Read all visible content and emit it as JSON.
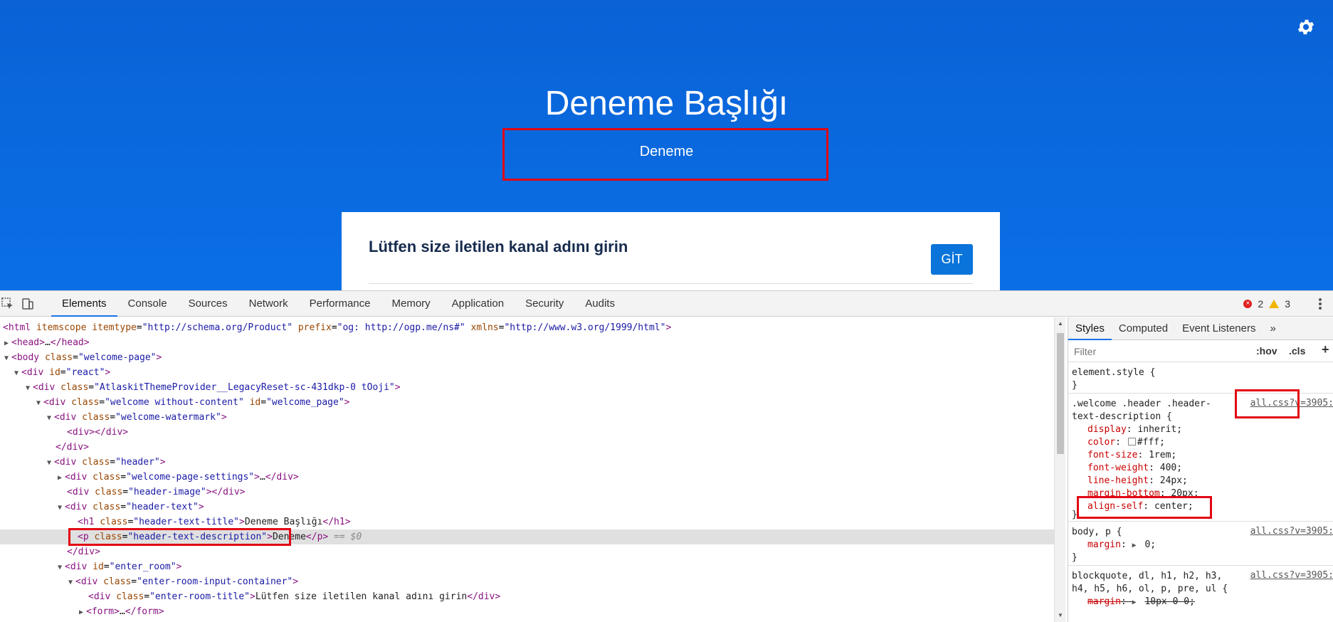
{
  "page": {
    "title": "Deneme Başlığı",
    "description": "Deneme",
    "card_title": "Lütfen size iletilen kanal adını girin",
    "go_button": "GİT",
    "settings_icon": "gear-icon",
    "background": "#0a6fe6"
  },
  "devtools": {
    "tabs": [
      "Elements",
      "Console",
      "Sources",
      "Network",
      "Performance",
      "Memory",
      "Application",
      "Security",
      "Audits"
    ],
    "error_count": "2",
    "warning_count": "3",
    "elements": {
      "l0": {
        "o": "<html ",
        "a1": "itemscope",
        "a2": " itemtype",
        "v2": "\"http://schema.org/Product\"",
        "a3": " prefix",
        "v3": "\"og: http://ogp.me/ns#\"",
        "a4": " xmlns",
        "v4": "\"http://www.w3.org/1999/html\"",
        "c": ">"
      },
      "l1": {
        "o": "<head>",
        "t": "…",
        "c": "</head>"
      },
      "l2": {
        "o": "<body ",
        "a": "class",
        "v": "\"welcome-page\"",
        "c": ">"
      },
      "l3": {
        "o": "<div ",
        "a": "id",
        "v": "\"react\"",
        "c": ">"
      },
      "l4": {
        "o": "<div ",
        "a": "class",
        "v": "\"AtlaskitThemeProvider__LegacyReset-sc-431dkp-0 tOoji\"",
        "c": ">"
      },
      "l5": {
        "o": "<div ",
        "a": "class",
        "v": "\"welcome without-content\"",
        "a2": " id",
        "v2": "\"welcome_page\"",
        "c": ">"
      },
      "l6": {
        "o": "<div ",
        "a": "class",
        "v": "\"welcome-watermark\"",
        "c": ">"
      },
      "l7": {
        "t": "<div></div>"
      },
      "l8": {
        "t": "</div>"
      },
      "l9": {
        "o": "<div ",
        "a": "class",
        "v": "\"header\"",
        "c": ">"
      },
      "l10": {
        "o": "<div ",
        "a": "class",
        "v": "\"welcome-page-settings\"",
        "c": ">",
        "t": "…",
        "e": "</div>"
      },
      "l11": {
        "o": "<div ",
        "a": "class",
        "v": "\"header-image\"",
        "c": "></div>"
      },
      "l12": {
        "o": "<div ",
        "a": "class",
        "v": "\"header-text\"",
        "c": ">"
      },
      "l13": {
        "o": "<h1 ",
        "a": "class",
        "v": "\"header-text-title\"",
        "c": ">",
        "t": "Deneme Başlığı",
        "e": "</h1>"
      },
      "l14": {
        "o": "<p ",
        "a": "class",
        "v": "\"header-text-description\"",
        "c": ">",
        "t": "Deneme",
        "e": "</p>",
        "d": " == $0"
      },
      "l15": {
        "t": "</div>"
      },
      "l16": {
        "o": "<div ",
        "a": "id",
        "v": "\"enter_room\"",
        "c": ">"
      },
      "l17": {
        "o": "<div ",
        "a": "class",
        "v": "\"enter-room-input-container\"",
        "c": ">"
      },
      "l18": {
        "o": "<div ",
        "a": "class",
        "v": "\"enter-room-title\"",
        "c": ">",
        "t": "Lütfen size iletilen kanal adını girin",
        "e": "</div>"
      },
      "l19": {
        "o": "<form>",
        "t": "…",
        "c": "</form>"
      }
    },
    "styles": {
      "tabs": [
        "Styles",
        "Computed",
        "Event Listeners"
      ],
      "more": "»",
      "filter_placeholder": "Filter",
      "hov": ":hov",
      "cls": ".cls",
      "add": "+",
      "element_style": "element.style {",
      "close": "}",
      "rule1_selector_1": ".welcome .header .header-",
      "rule1_selector_2": "text-description {",
      "rule1_source": "all.css?v=3905:",
      "rule1_props": [
        {
          "p": "display",
          "v": "inherit;"
        },
        {
          "p": "color",
          "v": "#fff;"
        },
        {
          "p": "font-size",
          "v": "1rem;"
        },
        {
          "p": "font-weight",
          "v": "400;"
        },
        {
          "p": "line-height",
          "v": "24px;"
        },
        {
          "p": "margin-bottom",
          "v": "20px;"
        },
        {
          "p": "align-self",
          "v": "center;"
        }
      ],
      "rule2_selector": "body, p {",
      "rule2_source": "all.css?v=3905:",
      "rule2_prop": "margin",
      "rule2_value": "0;",
      "rule3_selector_1": "blockquote, dl, h1, h2, h3,",
      "rule3_selector_2": "h4, h5, h6, ol, p, pre, ul {",
      "rule3_source": "all.css?v=3905:",
      "rule3_prop": "margin",
      "rule3_value": "10px 0 0;"
    }
  }
}
